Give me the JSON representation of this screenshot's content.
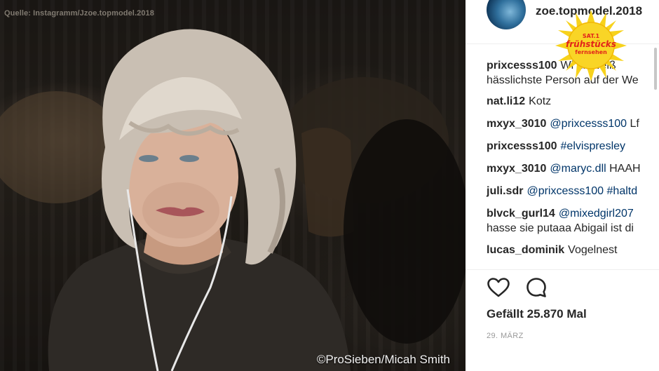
{
  "photo": {
    "source_caption": "Quelle: Instagramm/Jzoe.topmodel.2018",
    "copyright": "©ProSieben/Micah Smith"
  },
  "post": {
    "username": "zoe.topmodel.2018",
    "comments": [
      {
        "user": "prixcesss100",
        "parts": [
          {
            "text": "Wi...",
            "mention": false
          }
        ],
        "display": "Wi",
        "hidden_tail": "dir weiß",
        "line2": "hässlichste Person auf der We"
      },
      {
        "user": "nat.li12",
        "text": "Kotz"
      },
      {
        "user": "mxyx_3010",
        "mention": "@prixcesss100",
        "text": "Lf"
      },
      {
        "user": "prixcesss100",
        "mention": "#elvispresley",
        "text": ""
      },
      {
        "user": "mxyx_3010",
        "mention": "@maryc.dll",
        "text": "HAAH"
      },
      {
        "user": "juli.sdr",
        "mention": "@prixcesss100",
        "text": "#haltd"
      },
      {
        "user": "blvck_gurl14",
        "mention": "@mixedgirl207",
        "text": "",
        "line2": "hasse sie putaaa Abigail ist di"
      },
      {
        "user": "lucas_dominik",
        "text": "Vogelnest"
      }
    ],
    "likes": "Gefällt 25.870 Mal",
    "date": "29. MÄRZ"
  },
  "logo": {
    "line1": "SAT.1",
    "line2": "frühstücks",
    "line3": "fernsehen",
    "sun_color": "#f7d21c",
    "text_color": "#e2231a"
  },
  "icons": {
    "like": "heart-icon",
    "comment": "comment-bubble-icon",
    "avatar": "profile-avatar"
  }
}
